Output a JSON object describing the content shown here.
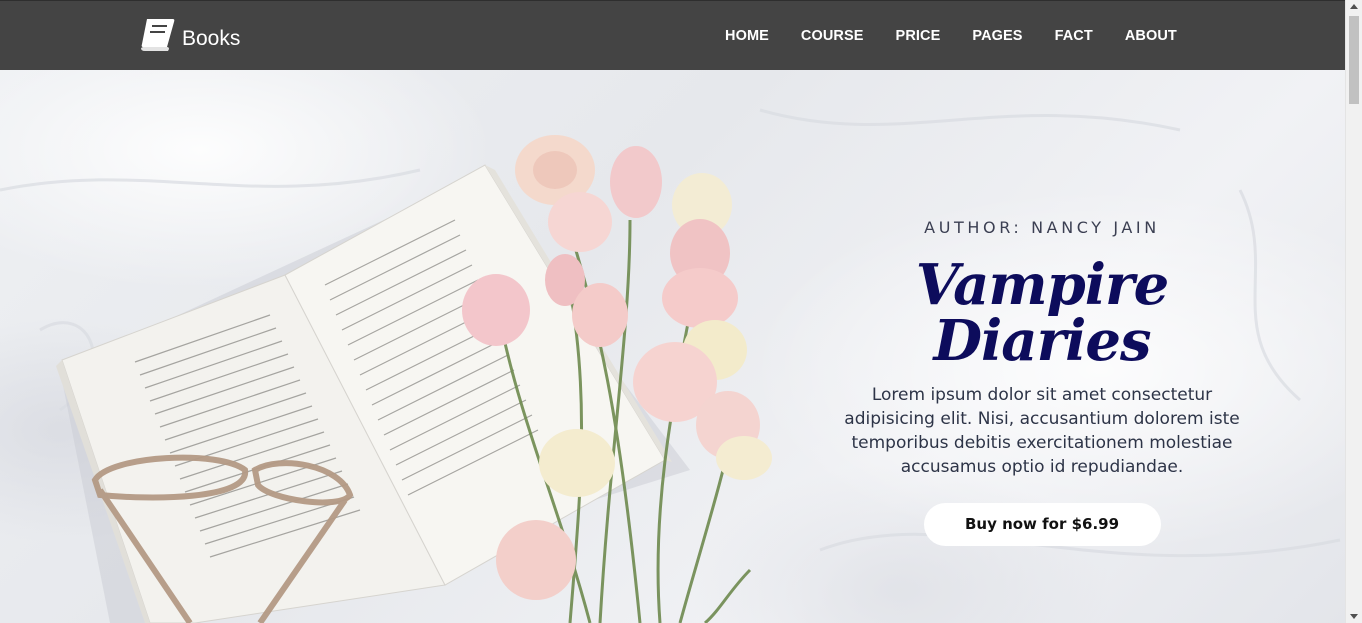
{
  "navbar": {
    "brand": "Books",
    "logo_icon": "book-icon",
    "links": [
      "HOME",
      "COURSE",
      "PRICE",
      "PAGES",
      "FACT",
      "ABOUT"
    ]
  },
  "hero": {
    "author": "AUTHOR: NANCY JAIN",
    "title": "Vampire Diaries",
    "description": "Lorem ipsum dolor sit amet consectetur adipisicing elit. Nisi, accusantium dolorem iste temporibus debitis exercitationem molestiae accusamus optio id repudiandae.",
    "button_label": "Buy now for $6.99",
    "image": "open-book-flowers-glasses-illustration"
  },
  "colors": {
    "navbar_bg": "#444444",
    "title": "#0d0c5c",
    "button_bg": "#ffffff"
  }
}
